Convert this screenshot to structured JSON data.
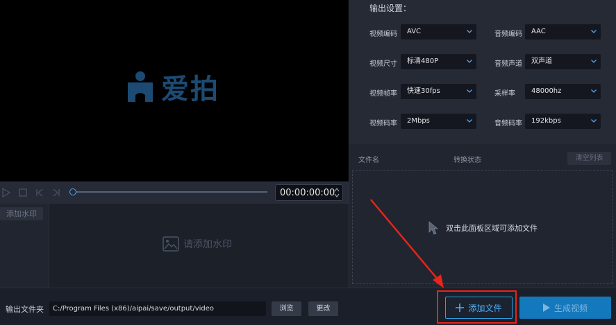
{
  "preview": {
    "logo_text": "爱拍"
  },
  "player": {
    "timecode": "00:00:00:00"
  },
  "watermark": {
    "add_button": "添加水印",
    "placeholder": "请添加水印"
  },
  "settings": {
    "title": "输出设置：",
    "fields": [
      {
        "label": "视频编码",
        "value": "AVC"
      },
      {
        "label": "音频编码",
        "value": "AAC"
      },
      {
        "label": "视频尺寸",
        "value": "标清480P"
      },
      {
        "label": "音频声道",
        "value": "双声道"
      },
      {
        "label": "视频帧率",
        "value": "快速30fps"
      },
      {
        "label": "采样率",
        "value": "48000hz"
      },
      {
        "label": "视频码率",
        "value": "2Mbps"
      },
      {
        "label": "音频码率",
        "value": "192kbps"
      }
    ]
  },
  "filelist": {
    "col_name": "文件名",
    "col_status": "转换状态",
    "clear_button": "清空列表",
    "drop_hint": "双击此面板区域可添加文件"
  },
  "output": {
    "label": "输出文件夹",
    "path": "C:/Program Files (x86)/aipai/save/output/video",
    "browse_button": "浏览",
    "change_button": "更改"
  },
  "actions": {
    "add_file": "添加文件",
    "generate_video": "生成视频"
  },
  "colors": {
    "accent": "#2f9fe6",
    "annotation_red": "#e8241b",
    "primary_button": "#1478bd"
  }
}
